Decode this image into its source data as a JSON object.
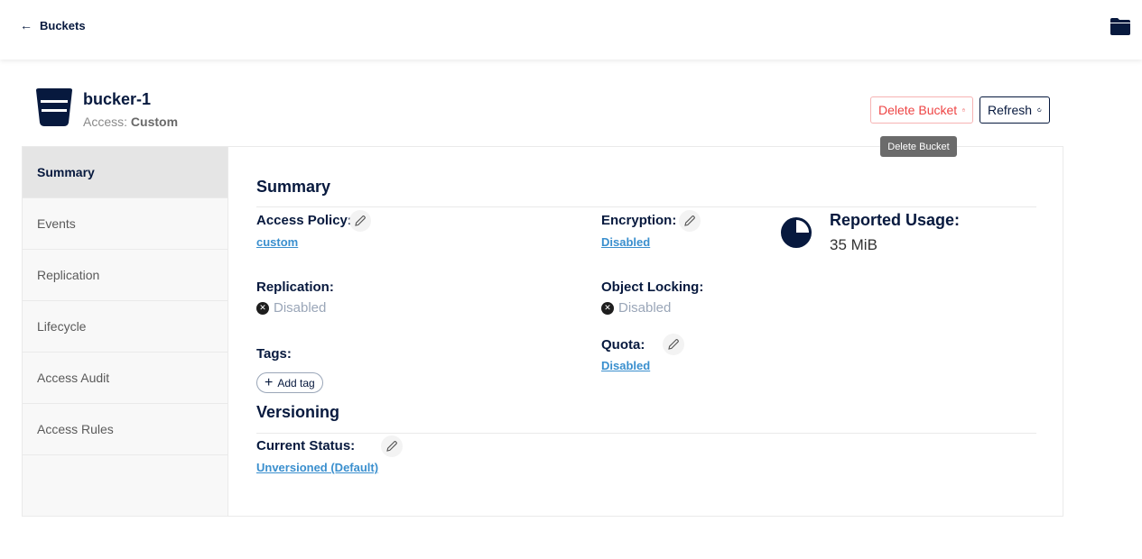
{
  "topbar": {
    "back_label": "Buckets",
    "back_icon": "arrow-left-icon",
    "folder_icon": "folder-icon"
  },
  "bucket": {
    "name": "bucker-1",
    "access_prefix": "Access:",
    "access_value": "Custom"
  },
  "actions": {
    "delete_label": "Delete Bucket",
    "refresh_label": "Refresh",
    "tooltip": "Delete Bucket"
  },
  "nav": {
    "items": [
      {
        "label": "Summary",
        "active": true
      },
      {
        "label": "Events",
        "active": false
      },
      {
        "label": "Replication",
        "active": false
      },
      {
        "label": "Lifecycle",
        "active": false
      },
      {
        "label": "Access Audit",
        "active": false
      },
      {
        "label": "Access Rules",
        "active": false
      }
    ]
  },
  "summary": {
    "title": "Summary",
    "access_policy_label": "Access Policy:",
    "access_policy_value": "custom",
    "encryption_label": "Encryption:",
    "encryption_value": "Disabled",
    "replication_label": "Replication:",
    "replication_value": "Disabled",
    "object_locking_label": "Object Locking:",
    "object_locking_value": "Disabled",
    "tags_label": "Tags:",
    "add_tag_label": "Add tag",
    "quota_label": "Quota:",
    "quota_value": "Disabled",
    "reported_usage_label": "Reported Usage:",
    "reported_usage_value": "35 MiB",
    "usage_fraction": 0.75
  },
  "versioning": {
    "title": "Versioning",
    "current_status_label": "Current Status:",
    "current_status_value": "Unversioned (Default)"
  },
  "colors": {
    "primary": "#07193e",
    "danger": "#ee4444",
    "link": "#3a8fce"
  }
}
